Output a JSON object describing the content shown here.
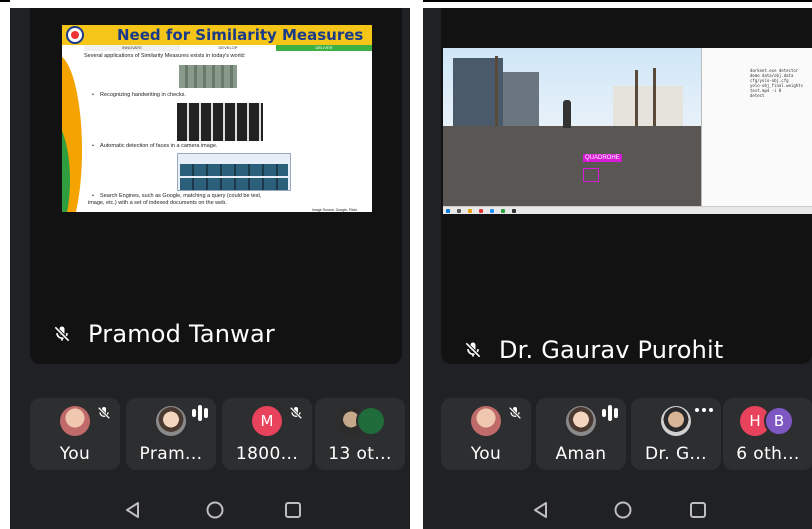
{
  "left_panel": {
    "speaker_name": "Pramod Tanwar",
    "slide": {
      "title": "Need for Similarity Measures",
      "tags": [
        "INNOVATE",
        "DEVELOP",
        "DELIVER"
      ],
      "intro": "Several applications of Similarity Measures exists in today's world:",
      "bullet1": "Recognizing handwriting in checks.",
      "bullet2": "Automatic detection of faces in a camera image.",
      "bullet3_line1": "Search Engines, such as Google, matching a query (could be text,",
      "bullet3_line2": "image, etc.) with a set of indexed documents on the web.",
      "source": "Image Source: Google, Flickr"
    },
    "participants": [
      {
        "label": "You",
        "avatar": "photo",
        "status": "muted-mic-icon"
      },
      {
        "label": "Pram...",
        "avatar": "photo",
        "status": "speaking-indicator-icon"
      },
      {
        "label": "1800...",
        "avatar": "M",
        "avatar_color": "#e8425c",
        "status": "muted-mic-icon"
      },
      {
        "label": "13 ot...",
        "avatar": "photos",
        "status": "none"
      }
    ]
  },
  "right_panel": {
    "speaker_name": "Dr. Gaurav Purohit",
    "video": {
      "detection_label": "QUADROHE",
      "terminal_lines": [
        "darknet.exe detector",
        "demo data/obj.data",
        "cfg/yolo-obj.cfg",
        "yolo-obj_final.weights",
        "test.mp4 -i 0",
        "",
        "detect"
      ]
    },
    "participants": [
      {
        "label": "You",
        "avatar": "photo",
        "status": "muted-mic-icon"
      },
      {
        "label": "Aman",
        "avatar": "photo",
        "status": "speaking-indicator-icon"
      },
      {
        "label": "Dr. G...",
        "avatar": "photo",
        "status": "more-dots-icon"
      },
      {
        "label": "6 oth...",
        "avatar": [
          "H",
          "B"
        ],
        "avatar_colors": [
          "#e8425c",
          "#7e57c2"
        ],
        "status": "none"
      }
    ]
  },
  "navigation": [
    "back-icon",
    "home-icon",
    "recents-icon"
  ]
}
